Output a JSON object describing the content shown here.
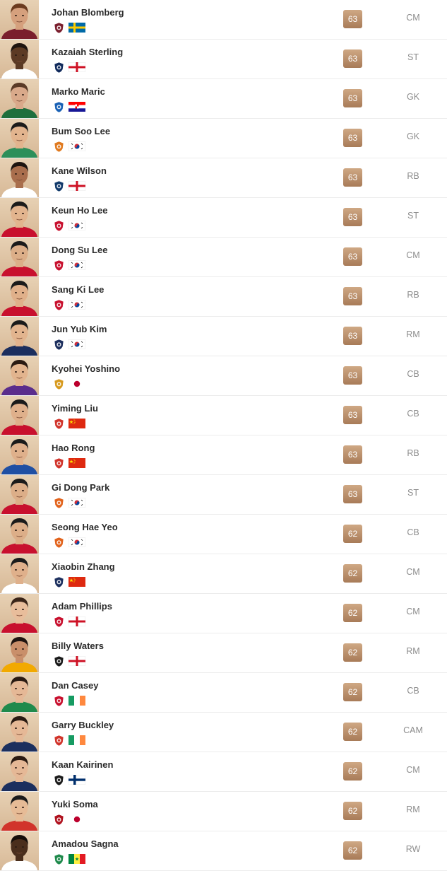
{
  "players": [
    {
      "name": "Johan Blomberg",
      "rating": "63",
      "position": "CM",
      "club_icon": "club-crest-maroon-icon",
      "nation": "Sweden",
      "flag_icon": "sweden-flag-icon",
      "skin": "#d5a07d",
      "hair": "#6b3b1f",
      "shirt": "#7a1e2d",
      "club_color": "#7a1e2d"
    },
    {
      "name": "Kazaiah Sterling",
      "rating": "63",
      "position": "ST",
      "club_icon": "club-crest-cockerel-icon",
      "nation": "England",
      "flag_icon": "england-flag-icon",
      "skin": "#5c3a24",
      "hair": "#1e1410",
      "shirt": "#ffffff",
      "club_color": "#102a5c"
    },
    {
      "name": "Marko Maric",
      "rating": "63",
      "position": "GK",
      "club_icon": "club-crest-blue-icon",
      "nation": "Croatia",
      "flag_icon": "croatia-flag-icon",
      "skin": "#d9a98a",
      "hair": "#5a3a26",
      "shirt": "#1f6f3d",
      "club_color": "#1961b5"
    },
    {
      "name": "Bum Soo Lee",
      "rating": "63",
      "position": "GK",
      "club_icon": "club-crest-green-orange-icon",
      "nation": "Korea Republic",
      "flag_icon": "korea-flag-icon",
      "skin": "#e2b48e",
      "hair": "#1b1b1b",
      "shirt": "#2d8f5a",
      "club_color": "#e07a1f"
    },
    {
      "name": "Kane Wilson",
      "rating": "63",
      "position": "RB",
      "club_icon": "club-crest-striped-icon",
      "nation": "England",
      "flag_icon": "england-flag-icon",
      "skin": "#a96e4d",
      "hair": "#1d1410",
      "shirt": "#ffffff",
      "club_color": "#123a6b"
    },
    {
      "name": "Keun Ho Lee",
      "rating": "63",
      "position": "ST",
      "club_icon": "club-crest-red-icon",
      "nation": "Korea Republic",
      "flag_icon": "korea-flag-icon",
      "skin": "#e2b48e",
      "hair": "#1b1b1b",
      "shirt": "#c8102e",
      "club_color": "#c8102e"
    },
    {
      "name": "Dong Su Lee",
      "rating": "63",
      "position": "CM",
      "club_icon": "club-crest-red-icon",
      "nation": "Korea Republic",
      "flag_icon": "korea-flag-icon",
      "skin": "#dcae88",
      "hair": "#1b1b1b",
      "shirt": "#c8102e",
      "club_color": "#c8102e"
    },
    {
      "name": "Sang Ki Lee",
      "rating": "63",
      "position": "RB",
      "club_icon": "club-crest-red-icon",
      "nation": "Korea Republic",
      "flag_icon": "korea-flag-icon",
      "skin": "#e0b08a",
      "hair": "#1b1b1b",
      "shirt": "#c8102e",
      "club_color": "#c8102e"
    },
    {
      "name": "Jun Yub Kim",
      "rating": "63",
      "position": "RM",
      "club_icon": "club-crest-navy-gold-icon",
      "nation": "Korea Republic",
      "flag_icon": "korea-flag-icon",
      "skin": "#e2b48e",
      "hair": "#1b1b1b",
      "shirt": "#1c2f5e",
      "club_color": "#1c2f5e"
    },
    {
      "name": "Kyohei Yoshino",
      "rating": "63",
      "position": "CB",
      "club_icon": "club-crest-gold-icon",
      "nation": "Japan",
      "flag_icon": "japan-flag-icon",
      "skin": "#e2b48e",
      "hair": "#2a1a12",
      "shirt": "#5a2d8c",
      "club_color": "#d79a1e"
    },
    {
      "name": "Yiming Liu",
      "rating": "63",
      "position": "CB",
      "club_icon": "club-crest-red-gold-icon",
      "nation": "China PR",
      "flag_icon": "china-flag-icon",
      "skin": "#dfb08b",
      "hair": "#1b1b1b",
      "shirt": "#c8102e",
      "club_color": "#d1342b"
    },
    {
      "name": "Hao Rong",
      "rating": "63",
      "position": "RB",
      "club_icon": "club-crest-red-gold-icon",
      "nation": "China PR",
      "flag_icon": "china-flag-icon",
      "skin": "#dfb08b",
      "hair": "#1b1b1b",
      "shirt": "#1f4fa3",
      "club_color": "#d1342b"
    },
    {
      "name": "Gi Dong Park",
      "rating": "63",
      "position": "ST",
      "club_icon": "club-crest-orange-icon",
      "nation": "Korea Republic",
      "flag_icon": "korea-flag-icon",
      "skin": "#dcae88",
      "hair": "#1b1b1b",
      "shirt": "#c8102e",
      "club_color": "#e2631c"
    },
    {
      "name": "Seong Hae Yeo",
      "rating": "62",
      "position": "CB",
      "club_icon": "club-crest-orange-icon",
      "nation": "Korea Republic",
      "flag_icon": "korea-flag-icon",
      "skin": "#dcae88",
      "hair": "#1b1b1b",
      "shirt": "#c8102e",
      "club_color": "#e2631c"
    },
    {
      "name": "Xiaobin Zhang",
      "rating": "62",
      "position": "CM",
      "club_icon": "club-crest-navy-gold-icon",
      "nation": "China PR",
      "flag_icon": "china-flag-icon",
      "skin": "#dfb08b",
      "hair": "#1b1b1b",
      "shirt": "#ffffff",
      "club_color": "#1c2f5e"
    },
    {
      "name": "Adam Phillips",
      "rating": "62",
      "position": "CM",
      "club_icon": "club-crest-red-icon",
      "nation": "England",
      "flag_icon": "england-flag-icon",
      "skin": "#e8bd9b",
      "hair": "#3a2418",
      "shirt": "#c8102e",
      "club_color": "#c8102e"
    },
    {
      "name": "Billy Waters",
      "rating": "62",
      "position": "RM",
      "club_icon": "club-crest-black-amber-icon",
      "nation": "England",
      "flag_icon": "england-flag-icon",
      "skin": "#c98f6a",
      "hair": "#1e1410",
      "shirt": "#f2a900",
      "club_color": "#1b1b1b"
    },
    {
      "name": "Dan Casey",
      "rating": "62",
      "position": "CB",
      "club_icon": "club-crest-red-black-icon",
      "nation": "Republic of Ireland",
      "flag_icon": "ireland-flag-icon",
      "skin": "#e5b896",
      "hair": "#2a1a12",
      "shirt": "#1f8a4c",
      "club_color": "#c8102e"
    },
    {
      "name": "Garry Buckley",
      "rating": "62",
      "position": "CAM",
      "club_icon": "club-crest-red-white-icon",
      "nation": "Republic of Ireland",
      "flag_icon": "ireland-flag-icon",
      "skin": "#e5b896",
      "hair": "#2a1a12",
      "shirt": "#1c2f5e",
      "club_color": "#d1342b"
    },
    {
      "name": "Kaan Kairinen",
      "rating": "62",
      "position": "CM",
      "club_icon": "club-crest-black-red-icon",
      "nation": "Finland",
      "flag_icon": "finland-flag-icon",
      "skin": "#e5b896",
      "hair": "#2a1a12",
      "shirt": "#1c2f5e",
      "club_color": "#1b1b1b"
    },
    {
      "name": "Yuki Soma",
      "rating": "62",
      "position": "RM",
      "club_icon": "club-crest-red-gold-icon",
      "nation": "Japan",
      "flag_icon": "japan-flag-icon",
      "skin": "#e6bb96",
      "hair": "#1b1b1b",
      "shirt": "#d1342b",
      "club_color": "#b0121f"
    },
    {
      "name": "Amadou Sagna",
      "rating": "62",
      "position": "RW",
      "club_icon": "club-crest-green-red-icon",
      "nation": "Senegal",
      "flag_icon": "senegal-flag-icon",
      "skin": "#4a2e1c",
      "hair": "#140d09",
      "shirt": "#ffffff",
      "club_color": "#1f8a4c"
    }
  ],
  "colors": {
    "rating_badge_top": "#cfa884",
    "rating_badge_bottom": "#a87b58",
    "photo_bg": "#e0c4a3",
    "name_text": "#2b2b2b",
    "position_text": "#8d8d8d",
    "row_divider": "#ececec"
  }
}
